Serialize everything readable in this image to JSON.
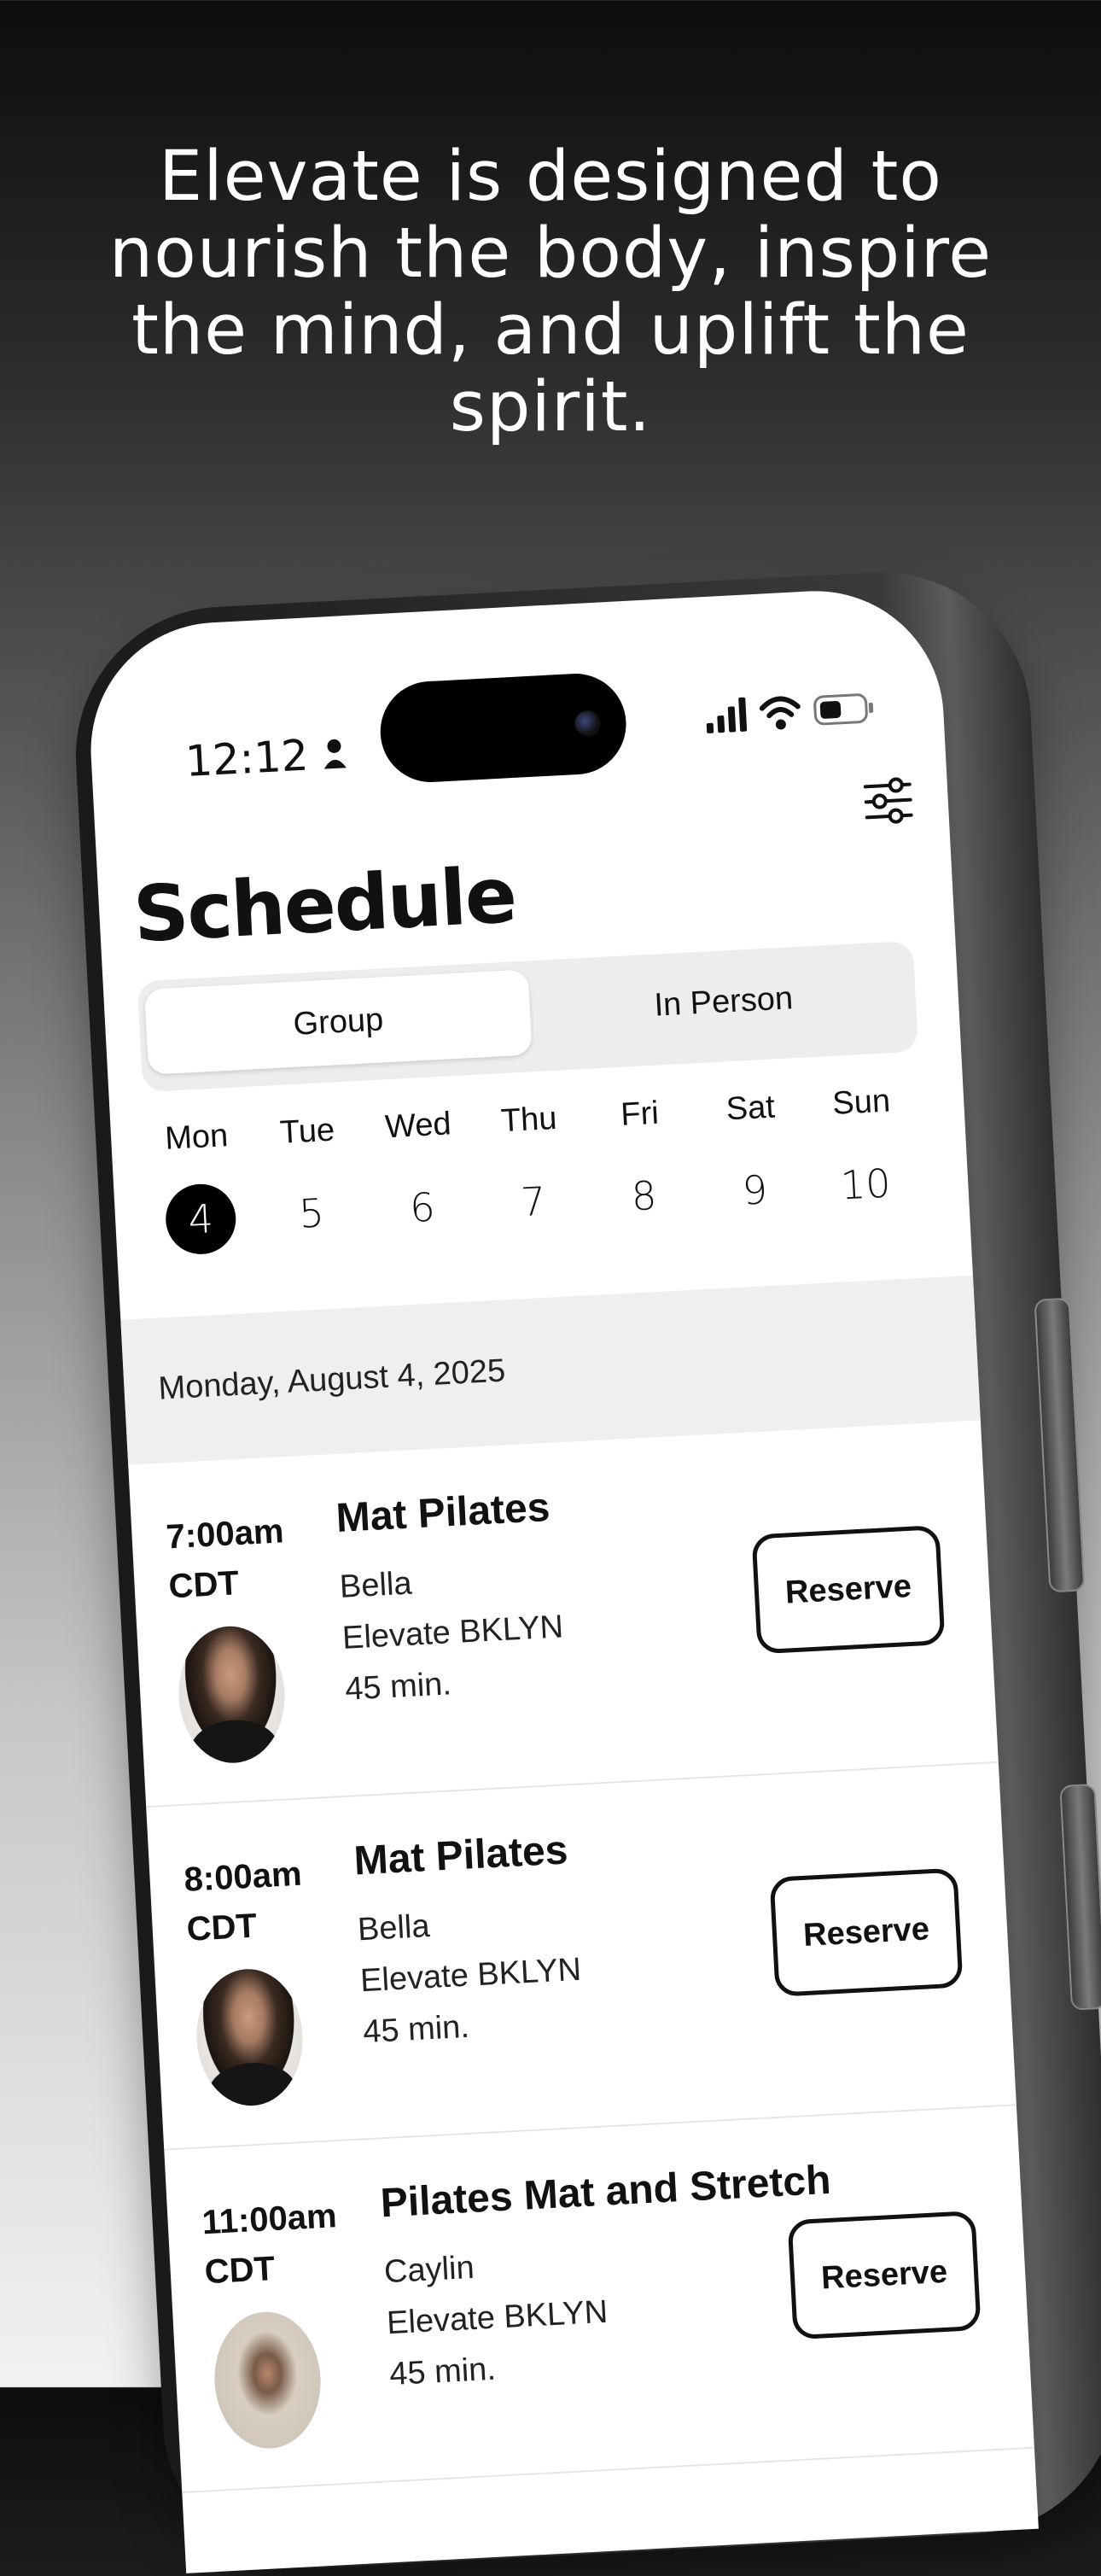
{
  "headline": "Elevate is designed to nourish the body, inspire the mind, and uplift the spirit.",
  "status_bar": {
    "time": "12:12"
  },
  "header": {
    "title": "Schedule"
  },
  "segmented": {
    "options": [
      "Group",
      "In Person"
    ],
    "selected": "Group"
  },
  "week": {
    "days": [
      {
        "name": "Mon",
        "num": "4",
        "selected": true
      },
      {
        "name": "Tue",
        "num": "5"
      },
      {
        "name": "Wed",
        "num": "6"
      },
      {
        "name": "Thu",
        "num": "7"
      },
      {
        "name": "Fri",
        "num": "8"
      },
      {
        "name": "Sat",
        "num": "9"
      },
      {
        "name": "Sun",
        "num": "10"
      }
    ]
  },
  "selected_date": "Monday, August 4, 2025",
  "classes": [
    {
      "time": "7:00am",
      "zone": "CDT",
      "name": "Mat Pilates",
      "instructor": "Bella",
      "location": "Elevate BKLYN",
      "duration": "45 min.",
      "action": "Reserve"
    },
    {
      "time": "8:00am",
      "zone": "CDT",
      "name": "Mat Pilates",
      "instructor": "Bella",
      "location": "Elevate BKLYN",
      "duration": "45 min.",
      "action": "Reserve"
    },
    {
      "time": "11:00am",
      "zone": "CDT",
      "name": "Pilates Mat and Stretch",
      "instructor": "Caylin",
      "location": "Elevate BKLYN",
      "duration": "45 min.",
      "action": "Reserve"
    }
  ]
}
